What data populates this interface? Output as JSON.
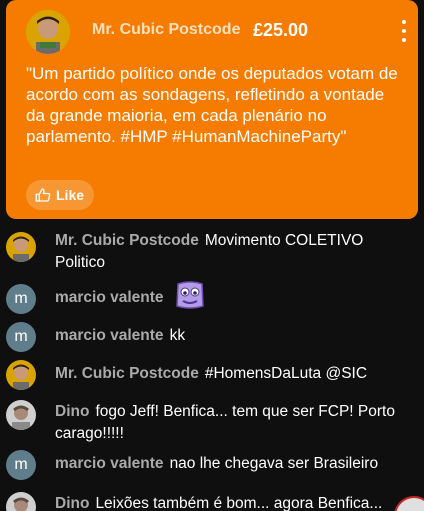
{
  "superchat": {
    "author": "Mr. Cubic Postcode",
    "amount": "£25.00",
    "message": "\"Um partido político onde os deputados votam de acordo com as sondagens, refletindo a vontade da grande maioria, em cada plenário no parlamento. #HMP #HumanMachineParty\"",
    "like_label": "Like",
    "background_color": "#f57c00"
  },
  "chat": [
    {
      "author": "Mr. Cubic Postcode",
      "avatar": "photo",
      "text": "Movimento COLETIVO Politico"
    },
    {
      "author": "marcio valente",
      "avatar": "m",
      "text": "",
      "emoji": "purple-face-emoji"
    },
    {
      "author": "marcio valente",
      "avatar": "m",
      "text": "kk"
    },
    {
      "author": "Mr. Cubic Postcode",
      "avatar": "photo",
      "text": "#HomensDaLuta @SIC"
    },
    {
      "author": "Dino",
      "avatar": "photo",
      "text": "fogo Jeff! Benfica... tem que ser FCP! Porto carago!!!!!"
    },
    {
      "author": "marcio valente",
      "avatar": "m",
      "text": "nao lhe chegava ser Brasileiro"
    },
    {
      "author": "Dino",
      "avatar": "photo",
      "text": "Leixões também é bom... agora Benfica..."
    }
  ]
}
